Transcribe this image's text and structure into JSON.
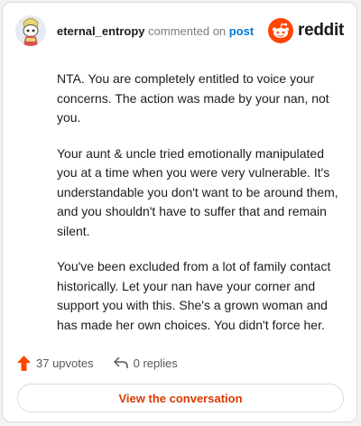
{
  "header": {
    "username": "eternal_entropy",
    "action_text": "commented on",
    "post_link": "post",
    "logo_text": "reddit",
    "logo_icon": "reddit-alien-icon",
    "avatar_icon": "snoo-avatar-icon"
  },
  "comment": {
    "paragraphs": [
      "NTA. You are completely entitled to voice your concerns. The action was made by your nan, not you.",
      "Your aunt & uncle tried emotionally manipulated you at a time when you were very vulnerable. It's understandable you don't want to be around them, and you shouldn't have to suffer that and remain silent.",
      "You've been excluded from a lot of family contact historically. Let your nan have your corner and support you with this. She's a grown woman and has made her own choices. You didn't force her."
    ]
  },
  "actions": {
    "upvotes": "37 upvotes",
    "replies": "0 replies",
    "upvote_icon": "upvote-arrow-icon",
    "reply_icon": "reply-arrow-icon"
  },
  "cta": {
    "label": "View the conversation"
  },
  "colors": {
    "brand": "#ff4500",
    "link": "#0079d3",
    "cta_text": "#d93a00"
  }
}
